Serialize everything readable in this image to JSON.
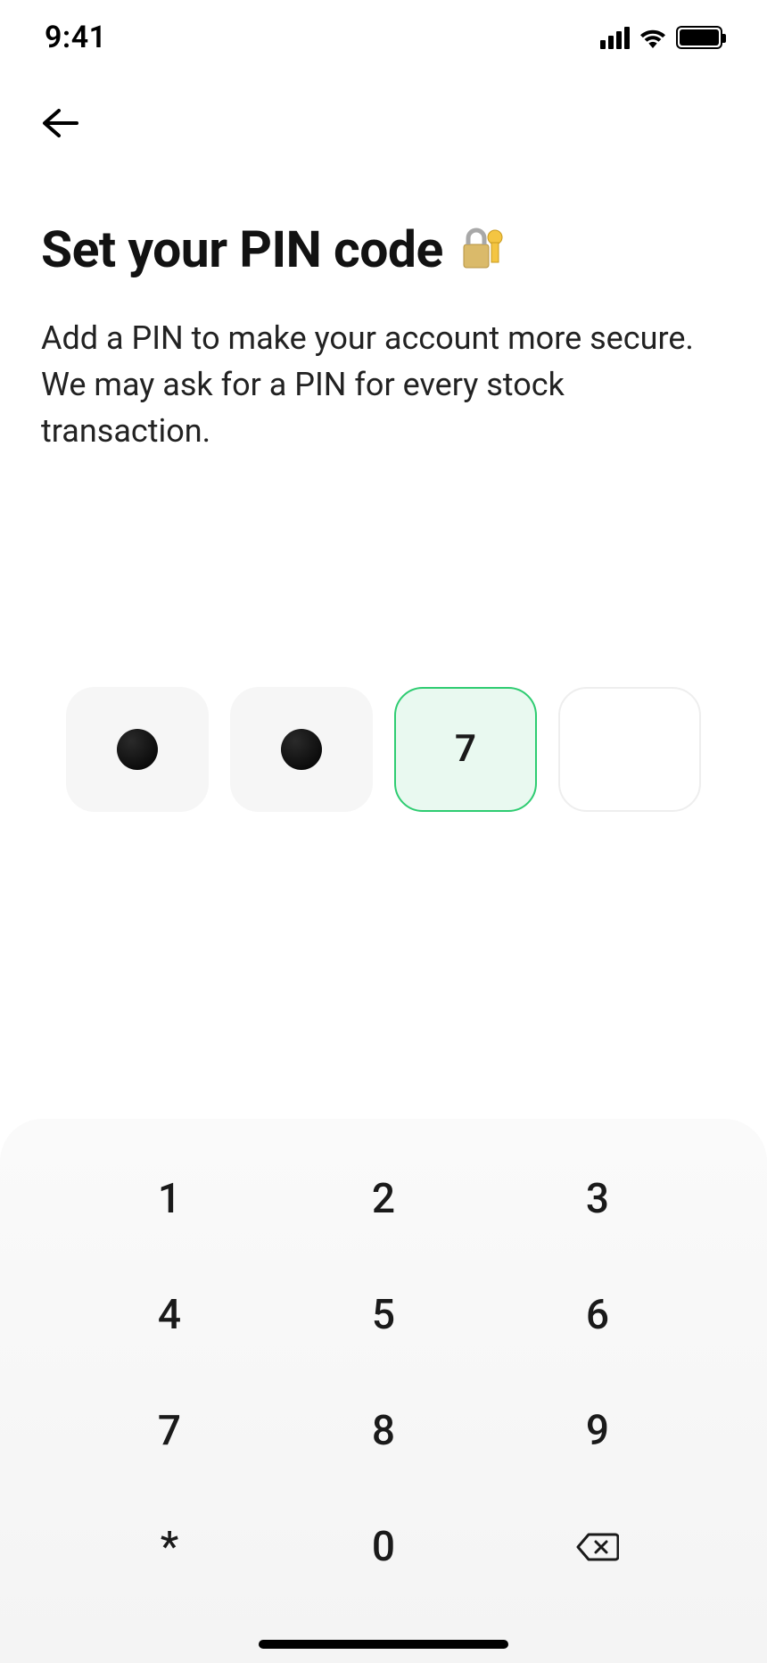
{
  "status": {
    "time": "9:41"
  },
  "page": {
    "title": "Set your PIN code",
    "subtitle": "Add a PIN to make your account more secure. We may ask for a PIN for every stock transaction."
  },
  "pin": {
    "current_digit": "7"
  },
  "keypad": {
    "k1": "1",
    "k2": "2",
    "k3": "3",
    "k4": "4",
    "k5": "5",
    "k6": "6",
    "k7": "7",
    "k8": "8",
    "k9": "9",
    "star": "*",
    "k0": "0"
  }
}
